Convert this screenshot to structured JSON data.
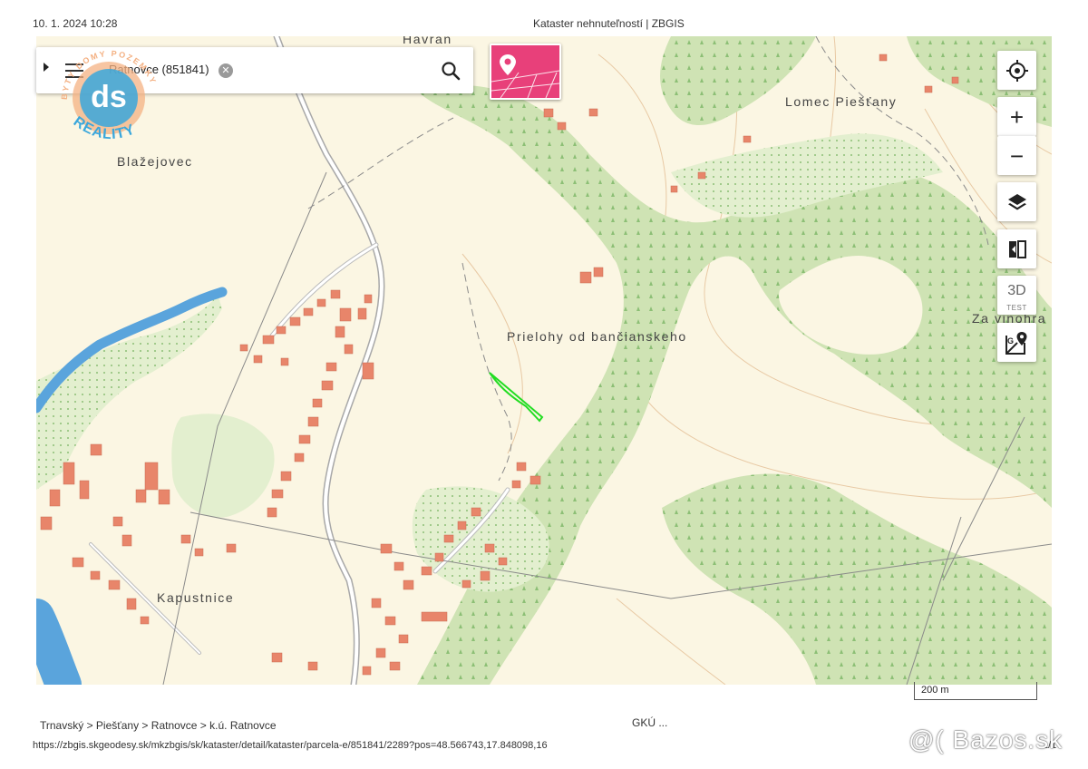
{
  "print": {
    "date": "10. 1. 2024 10:28",
    "title": "Kataster nehnuteľností | ZBGIS"
  },
  "search": {
    "value": "Ratnovce (851841)",
    "icons": [
      "menu-icon",
      "clear-icon",
      "search-icon"
    ]
  },
  "controls": {
    "zoom_in": "+",
    "zoom_out": "−",
    "three_d": "3D",
    "three_d_sub": "TEST",
    "icons": [
      "locate-icon",
      "layers-icon",
      "compare-icon",
      "google-maps-icon"
    ]
  },
  "map": {
    "labels": {
      "havran": "Havran",
      "lomec": "Lomec Piešťany",
      "blazejovec": "Blažejovec",
      "prielohy": "Prielohy od bančianskeho",
      "za_vinohra": "Za vinohra",
      "kapustnice": "Kapustnice"
    },
    "scale": "200 m",
    "colors": {
      "forest": "#cfe3b4",
      "parcel": "#22dd22",
      "building": "#e8856a",
      "cadastre_button": "#e8407a"
    }
  },
  "watermark": {
    "brand": "ds",
    "top_text": "BYTY DOMY POZEMKY",
    "bottom_text": "REALITY"
  },
  "footer": {
    "breadcrumb": "Trnavský > Piešťany > Ratnovce > k.ú. Ratnovce",
    "gku": "GKÚ ...",
    "url": "https://zbgis.skgeodesy.sk/mkzbgis/sk/kataster/detail/kataster/parcela-e/851841/2289?pos=48.566743,17.848098,16",
    "page": "1/1",
    "site": "@( Bazos.sk"
  }
}
